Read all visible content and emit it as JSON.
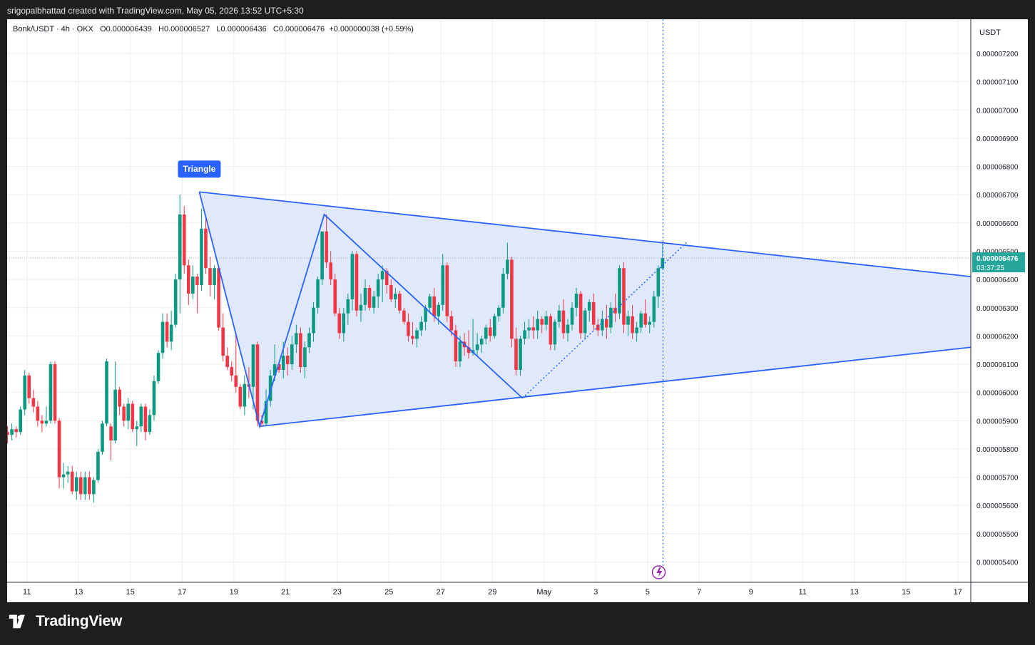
{
  "caption": "srigopalbhattad created with TradingView.com, May 05, 2026 13:52 UTC+5:30",
  "brand": {
    "name": "TradingView",
    "logo_icon": "tradingview-logo-icon"
  },
  "legend": {
    "symbol": "Bonk/USDT · 4h · OKX",
    "open_label": "O",
    "open": "0.000006439",
    "high_label": "H",
    "high": "0.000006527",
    "low_label": "L",
    "low": "0.000006436",
    "close_label": "C",
    "close": "0.000006476",
    "change": "+0.000000038 (+0.59%)"
  },
  "price_axis": {
    "currency": "USDT",
    "ticks": [
      "0.000007200",
      "0.000007100",
      "0.000007000",
      "0.000006900",
      "0.000006800",
      "0.000006700",
      "0.000006600",
      "0.000006500",
      "0.000006400",
      "0.000006300",
      "0.000006200",
      "0.000006100",
      "0.000006000",
      "0.000005900",
      "0.000005800",
      "0.000005700",
      "0.000005600",
      "0.000005500",
      "0.000005400"
    ],
    "last_price_label": "0.000006476",
    "countdown": "03:37:25"
  },
  "time_axis": {
    "ticks": [
      "11",
      "13",
      "15",
      "17",
      "19",
      "21",
      "23",
      "25",
      "27",
      "29",
      "May",
      "3",
      "5",
      "7",
      "9",
      "11",
      "13",
      "15",
      "17"
    ]
  },
  "drawing": {
    "label": "Triangle"
  },
  "realtime_icon": "lightning-icon",
  "colors": {
    "up": "#089981",
    "down": "#f23645",
    "triangle_line": "#2962ff",
    "triangle_fill": "#dbe5fb",
    "last_price_bg": "#26a69a",
    "label_bg": "#2962ff"
  },
  "chart_data": {
    "type": "candlestick",
    "title": "Bonk/USDT · 4h · OKX",
    "xlabel": "",
    "ylabel": "USDT",
    "ylim": [
      5.35e-06,
      7.3e-06
    ],
    "x_range": [
      "Apr 10",
      "May 17"
    ],
    "grid": true,
    "scale": 1e-09,
    "candles": [
      [
        5880,
        5920,
        5850,
        5860
      ],
      [
        5860,
        5880,
        5820,
        5850
      ],
      [
        5850,
        5890,
        5830,
        5870
      ],
      [
        5870,
        5880,
        5840,
        5860
      ],
      [
        5860,
        5950,
        5850,
        5940
      ],
      [
        5940,
        6080,
        5920,
        6060
      ],
      [
        6060,
        6070,
        5960,
        5980
      ],
      [
        5980,
        6010,
        5930,
        5950
      ],
      [
        5950,
        5970,
        5880,
        5900
      ],
      [
        5900,
        5920,
        5860,
        5890
      ],
      [
        5890,
        5950,
        5880,
        5900
      ],
      [
        5900,
        6110,
        5890,
        6100
      ],
      [
        6100,
        6110,
        5890,
        5900
      ],
      [
        5900,
        5910,
        5660,
        5700
      ],
      [
        5700,
        5750,
        5660,
        5710
      ],
      [
        5710,
        5740,
        5680,
        5720
      ],
      [
        5720,
        5740,
        5640,
        5650
      ],
      [
        5650,
        5720,
        5620,
        5700
      ],
      [
        5700,
        5720,
        5620,
        5640
      ],
      [
        5640,
        5720,
        5620,
        5700
      ],
      [
        5700,
        5720,
        5620,
        5640
      ],
      [
        5640,
        5700,
        5610,
        5690
      ],
      [
        5690,
        5800,
        5680,
        5790
      ],
      [
        5790,
        5900,
        5780,
        5890
      ],
      [
        5890,
        6120,
        5880,
        6110
      ],
      [
        5880,
        5890,
        5760,
        5830
      ],
      [
        5830,
        6110,
        5820,
        6010
      ],
      [
        6010,
        6020,
        5920,
        5950
      ],
      [
        5950,
        5960,
        5880,
        5900
      ],
      [
        5900,
        5980,
        5870,
        5960
      ],
      [
        5960,
        5970,
        5860,
        5870
      ],
      [
        5870,
        5900,
        5810,
        5880
      ],
      [
        5880,
        5960,
        5860,
        5950
      ],
      [
        5950,
        5960,
        5830,
        5860
      ],
      [
        5860,
        5940,
        5850,
        5920
      ],
      [
        5920,
        6060,
        5900,
        6040
      ],
      [
        6040,
        6150,
        6030,
        6140
      ],
      [
        6140,
        6280,
        6120,
        6250
      ],
      [
        6250,
        6280,
        6160,
        6180
      ],
      [
        6180,
        6290,
        6150,
        6240
      ],
      [
        6240,
        6420,
        6230,
        6400
      ],
      [
        6400,
        6700,
        6280,
        6630
      ],
      [
        6630,
        6660,
        6420,
        6450
      ],
      [
        6450,
        6470,
        6310,
        6350
      ],
      [
        6350,
        6450,
        6330,
        6410
      ],
      [
        6410,
        6420,
        6280,
        6380
      ],
      [
        6380,
        6650,
        6360,
        6580
      ],
      [
        6580,
        6620,
        6420,
        6440
      ],
      [
        6440,
        6480,
        6340,
        6380
      ],
      [
        6380,
        6450,
        6330,
        6440
      ],
      [
        6440,
        6450,
        6220,
        6230
      ],
      [
        6230,
        6280,
        6110,
        6130
      ],
      [
        6130,
        6160,
        6080,
        6090
      ],
      [
        6090,
        6110,
        6040,
        6060
      ],
      [
        6060,
        6200,
        6000,
        6020
      ],
      [
        6020,
        6030,
        5940,
        5950
      ],
      [
        5950,
        6060,
        5920,
        6030
      ],
      [
        6030,
        6090,
        5980,
        6020
      ],
      [
        6020,
        6130,
        5940,
        6170
      ],
      [
        6170,
        6180,
        5880,
        5900
      ],
      [
        5900,
        5920,
        5880,
        5890
      ],
      [
        5890,
        6010,
        5880,
        5970
      ],
      [
        5970,
        6080,
        5950,
        6060
      ],
      [
        6060,
        6170,
        6040,
        6100
      ],
      [
        6100,
        6110,
        6070,
        6080
      ],
      [
        6080,
        6180,
        6050,
        6130
      ],
      [
        6130,
        6160,
        6060,
        6100
      ],
      [
        6100,
        6200,
        6080,
        6170
      ],
      [
        6170,
        6240,
        6140,
        6210
      ],
      [
        6210,
        6230,
        6070,
        6090
      ],
      [
        6090,
        6180,
        6050,
        6160
      ],
      [
        6160,
        6230,
        6140,
        6210
      ],
      [
        6210,
        6320,
        6180,
        6300
      ],
      [
        6300,
        6410,
        6280,
        6400
      ],
      [
        6400,
        6530,
        6380,
        6570
      ],
      [
        6570,
        6630,
        6440,
        6460
      ],
      [
        6460,
        6500,
        6380,
        6400
      ],
      [
        6400,
        6420,
        6270,
        6280
      ],
      [
        6280,
        6300,
        6190,
        6210
      ],
      [
        6210,
        6300,
        6180,
        6280
      ],
      [
        6280,
        6350,
        6240,
        6330
      ],
      [
        6330,
        6500,
        6290,
        6490
      ],
      [
        6490,
        6500,
        6270,
        6290
      ],
      [
        6290,
        6350,
        6250,
        6310
      ],
      [
        6310,
        6400,
        6290,
        6370
      ],
      [
        6370,
        6380,
        6290,
        6300
      ],
      [
        6300,
        6360,
        6280,
        6340
      ],
      [
        6340,
        6420,
        6300,
        6400
      ],
      [
        6400,
        6450,
        6320,
        6430
      ],
      [
        6430,
        6440,
        6350,
        6380
      ],
      [
        6380,
        6400,
        6320,
        6330
      ],
      [
        6330,
        6370,
        6300,
        6350
      ],
      [
        6350,
        6360,
        6280,
        6290
      ],
      [
        6290,
        6300,
        6240,
        6250
      ],
      [
        6250,
        6280,
        6180,
        6200
      ],
      [
        6200,
        6250,
        6170,
        6190
      ],
      [
        6190,
        6230,
        6160,
        6220
      ],
      [
        6220,
        6270,
        6200,
        6250
      ],
      [
        6250,
        6310,
        6220,
        6300
      ],
      [
        6300,
        6350,
        6280,
        6340
      ],
      [
        6340,
        6370,
        6250,
        6270
      ],
      [
        6270,
        6320,
        6240,
        6310
      ],
      [
        6310,
        6490,
        6290,
        6450
      ],
      [
        6450,
        6460,
        6250,
        6270
      ],
      [
        6270,
        6290,
        6200,
        6220
      ],
      [
        6220,
        6240,
        6090,
        6110
      ],
      [
        6110,
        6200,
        6090,
        6180
      ],
      [
        6180,
        6210,
        6130,
        6160
      ],
      [
        6160,
        6220,
        6120,
        6140
      ],
      [
        6140,
        6260,
        6130,
        6150
      ],
      [
        6150,
        6210,
        6130,
        6170
      ],
      [
        6170,
        6200,
        6140,
        6190
      ],
      [
        6190,
        6240,
        6170,
        6230
      ],
      [
        6230,
        6260,
        6180,
        6200
      ],
      [
        6200,
        6280,
        6190,
        6270
      ],
      [
        6270,
        6310,
        6250,
        6300
      ],
      [
        6300,
        6440,
        6280,
        6420
      ],
      [
        6420,
        6530,
        6400,
        6470
      ],
      [
        6470,
        6480,
        6160,
        6190
      ],
      [
        6190,
        6230,
        6060,
        6080
      ],
      [
        6080,
        6200,
        6060,
        6190
      ],
      [
        6190,
        6250,
        6170,
        6220
      ],
      [
        6220,
        6260,
        6190,
        6230
      ],
      [
        6230,
        6270,
        6190,
        6220
      ],
      [
        6220,
        6290,
        6190,
        6260
      ],
      [
        6260,
        6270,
        6210,
        6240
      ],
      [
        6240,
        6290,
        6220,
        6270
      ],
      [
        6270,
        6280,
        6150,
        6170
      ],
      [
        6170,
        6260,
        6150,
        6250
      ],
      [
        6250,
        6310,
        6230,
        6290
      ],
      [
        6290,
        6330,
        6190,
        6210
      ],
      [
        6210,
        6260,
        6180,
        6240
      ],
      [
        6240,
        6320,
        6220,
        6300
      ],
      [
        6300,
        6370,
        6270,
        6350
      ],
      [
        6350,
        6360,
        6190,
        6210
      ],
      [
        6210,
        6300,
        6190,
        6290
      ],
      [
        6290,
        6330,
        6250,
        6320
      ],
      [
        6320,
        6350,
        6220,
        6240
      ],
      [
        6240,
        6260,
        6200,
        6220
      ],
      [
        6220,
        6290,
        6200,
        6260
      ],
      [
        6260,
        6310,
        6190,
        6230
      ],
      [
        6230,
        6320,
        6210,
        6300
      ],
      [
        6300,
        6350,
        6250,
        6280
      ],
      [
        6280,
        6450,
        6260,
        6440
      ],
      [
        6440,
        6460,
        6210,
        6240
      ],
      [
        6240,
        6290,
        6200,
        6270
      ],
      [
        6270,
        6310,
        6190,
        6210
      ],
      [
        6210,
        6250,
        6180,
        6230
      ],
      [
        6230,
        6290,
        6210,
        6280
      ],
      [
        6280,
        6330,
        6230,
        6240
      ],
      [
        6240,
        6270,
        6210,
        6250
      ],
      [
        6250,
        6360,
        6230,
        6340
      ],
      [
        6340,
        6450,
        6300,
        6440
      ],
      [
        6439,
        6527,
        6436,
        6476
      ]
    ],
    "annotations": [
      {
        "type": "triangle",
        "label": "Triangle",
        "points": [
          [
            "Apr 17 16:00",
            6.71e-06
          ],
          [
            "Apr 20 00:00",
            5.88e-06
          ],
          [
            "Apr 30 04:00",
            5.98e-06
          ]
        ],
        "extended_to": "May 17",
        "right_edge_values": [
          6.41e-06,
          6.16e-06
        ]
      },
      {
        "type": "zigzag",
        "points": [
          [
            "Apr 17 16:00",
            6.71e-06
          ],
          [
            "Apr 20 00:00",
            5.88e-06
          ],
          [
            "Apr 22 12:00",
            6.63e-06
          ],
          [
            "Apr 30 04:00",
            5.98e-06
          ],
          [
            "May 05 12:00",
            6.53e-06
          ]
        ]
      }
    ],
    "last_price": 6.476e-06
  }
}
